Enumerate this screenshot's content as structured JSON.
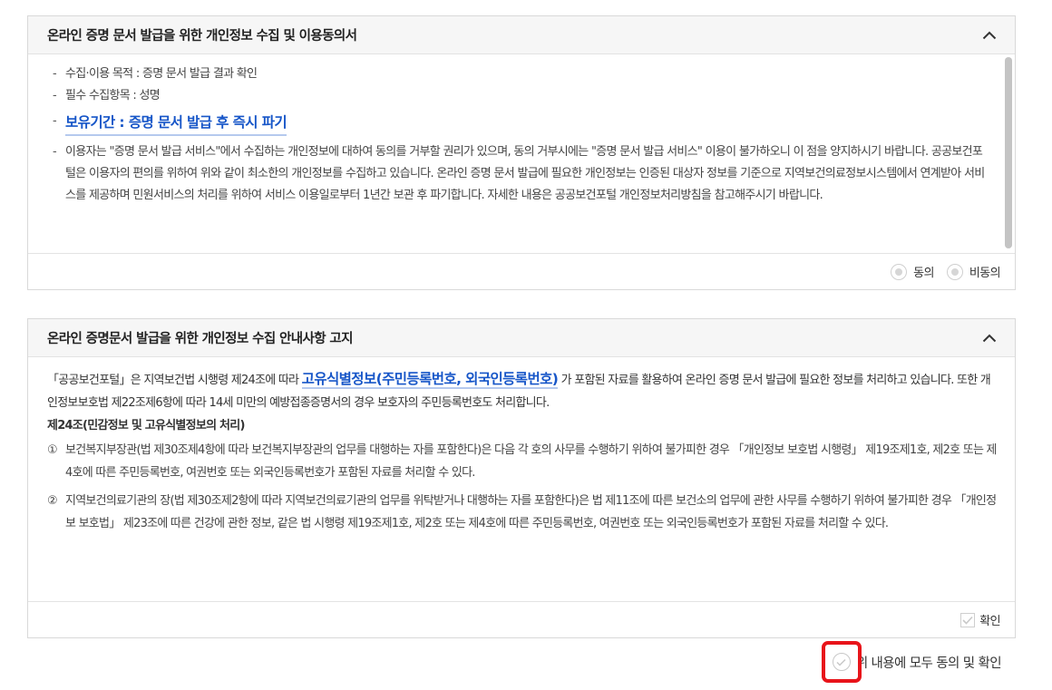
{
  "consent_panel": {
    "title": "온라인 증명 문서 발급을 위한 개인정보 수집 및 이용동의서",
    "items": [
      "수집·이용 목적 : 증명 문서 발급 결과 확인",
      "필수 수집항목 : 성명",
      "보유기간 : 증명 문서 발급 후 즉시 파기",
      "이용자는 \"증명 문서 발급 서비스\"에서 수집하는 개인정보에 대하여 동의를 거부할 권리가 있으며, 동의 거부시에는 \"증명 문서 발급 서비스\" 이용이 불가하오니 이 점을 양지하시기 바랍니다. 공공보건포털은 이용자의 편의를 위하여 위와 같이 최소한의 개인정보를 수집하고 있습니다. 온라인 증명 문서 발급에 필요한 개인정보는 인증된 대상자 정보를 기준으로 지역보건의료정보시스템에서 연계받아 서비스를 제공하며 민원서비스의 처리를 위하여 서비스 이용일로부터 1년간 보관 후 파기합니다. 자세한 내용은 공공보건포털 개인정보처리방침을 참고해주시기 바랍니다."
    ],
    "options": {
      "agree": "동의",
      "disagree": "비동의"
    }
  },
  "notice_panel": {
    "title": "온라인 증명문서 발급을 위한 개인정보 수집 안내사항 고지",
    "intro_prefix": "「공공보건포털」은 지역보건법 시행령 제24조에 따라",
    "intro_highlight": "고유식별정보(주민등록번호, 외국인등록번호)",
    "intro_suffix": "가 포함된 자료를 활용하여 온라인 증명 문서 발급에 필요한 정보를 처리하고 있습니다. 또한 개인정보보호법 제22조제6항에 따라 14세 미만의 예방접종증명서의 경우 보호자의 주민등록번호도 처리합니다.",
    "article_title": "제24조(민감정보 및 고유식별정보의 처리)",
    "clauses": [
      {
        "num": "①",
        "text": "보건복지부장관(법 제30조제4항에 따라 보건복지부장관의 업무를 대행하는 자를 포함한다)은 다음 각 호의 사무를 수행하기 위하여 불가피한 경우 「개인정보 보호법 시행령」 제19조제1호, 제2호 또는 제4호에 따른 주민등록번호, 여권번호 또는 외국인등록번호가 포함된 자료를 처리할 수 있다."
      },
      {
        "num": "②",
        "text": "지역보건의료기관의 장(법 제30조제2항에 따라 지역보건의료기관의 업무를 위탁받거나 대행하는 자를 포함한다)은 법 제11조에 따른 보건소의 업무에 관한 사무를 수행하기 위하여 불가피한 경우 「개인정보 보호법」 제23조에 따른 건강에 관한 정보, 같은 법 시행령 제19조제1호, 제2호 또는 제4호에 따른 주민등록번호, 여권번호 또는 외국인등록번호가 포함된 자료를 처리할 수 있다."
      }
    ],
    "confirm_label": "확인"
  },
  "agree_all_label": "위 내용에 모두 동의 및 확인"
}
